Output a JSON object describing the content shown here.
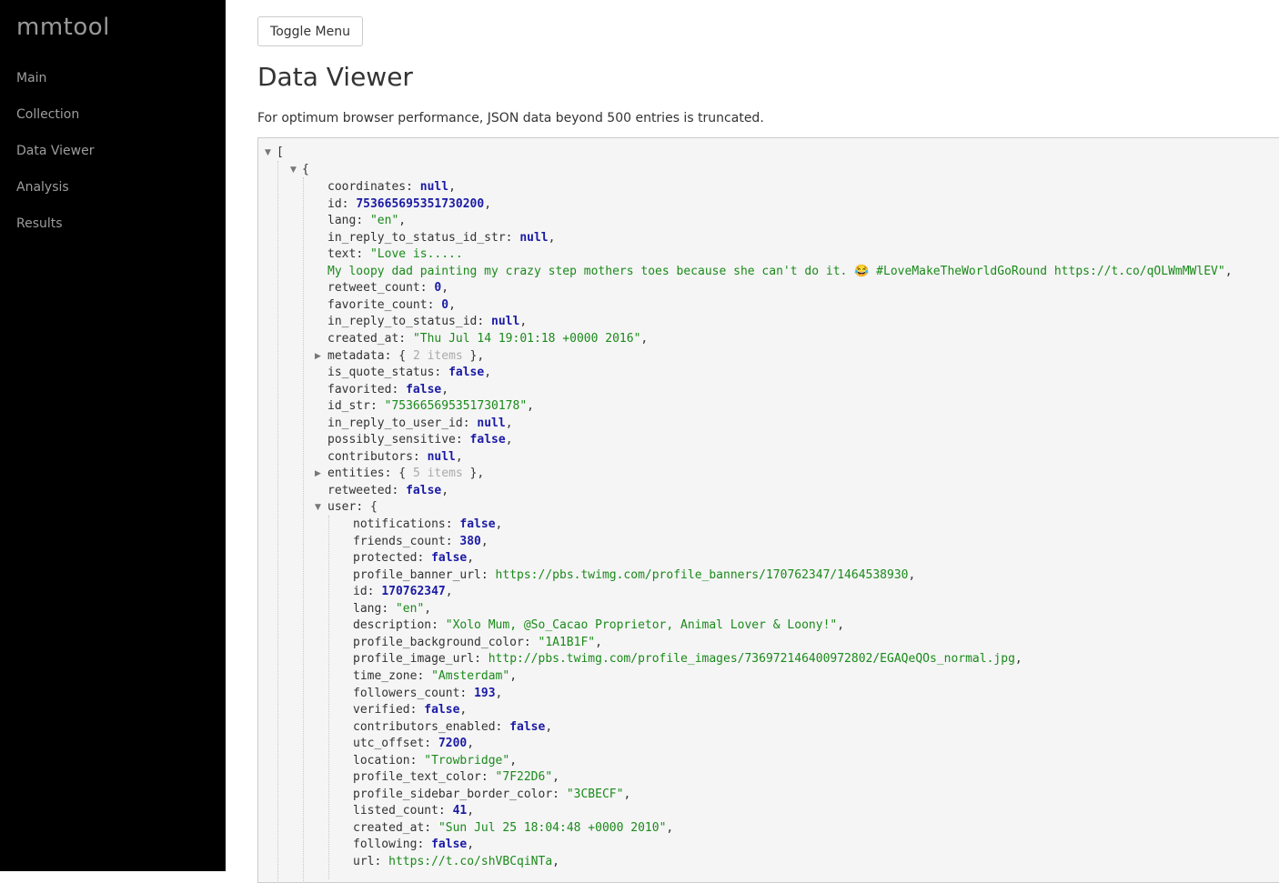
{
  "app": {
    "brand": "mmtool",
    "nav": [
      "Main",
      "Collection",
      "Data Viewer",
      "Analysis",
      "Results"
    ]
  },
  "toolbar": {
    "toggle_label": "Toggle Menu"
  },
  "page": {
    "title": "Data Viewer",
    "notice": "For optimum browser performance, JSON data beyond 500 entries is truncated."
  },
  "colors": {
    "sidebar_bg": "#000000",
    "viewer_bg": "#f5f5f5",
    "string": "#1a8a1a",
    "literal": "#1a1aa6",
    "collapsed_hint": "#aaaaaa"
  },
  "icons": {
    "expanded": "triangle-down-icon",
    "collapsed": "triangle-right-icon"
  },
  "json": {
    "root_open": "[",
    "item_open": "{",
    "fields": [
      {
        "key": "coordinates",
        "value": "null",
        "type": "literal"
      },
      {
        "key": "id",
        "value": "753665695351730200",
        "type": "literal"
      },
      {
        "key": "lang",
        "value": "\"en\"",
        "type": "string"
      },
      {
        "key": "in_reply_to_status_id_str",
        "value": "null",
        "type": "literal"
      },
      {
        "key": "text",
        "value": "\"Love is.....",
        "type": "string"
      },
      {
        "key": "retweet_count",
        "value": "0",
        "type": "literal"
      },
      {
        "key": "favorite_count",
        "value": "0",
        "type": "literal"
      },
      {
        "key": "in_reply_to_status_id",
        "value": "null",
        "type": "literal"
      },
      {
        "key": "created_at",
        "value": "\"Thu Jul 14 19:01:18 +0000 2016\"",
        "type": "string"
      },
      {
        "key": "metadata",
        "value": "2 items",
        "type": "collapsed"
      },
      {
        "key": "is_quote_status",
        "value": "false",
        "type": "literal"
      },
      {
        "key": "favorited",
        "value": "false",
        "type": "literal"
      },
      {
        "key": "id_str",
        "value": "\"753665695351730178\"",
        "type": "string"
      },
      {
        "key": "in_reply_to_user_id",
        "value": "null",
        "type": "literal"
      },
      {
        "key": "possibly_sensitive",
        "value": "false",
        "type": "literal"
      },
      {
        "key": "contributors",
        "value": "null",
        "type": "literal"
      },
      {
        "key": "entities",
        "value": "5 items",
        "type": "collapsed"
      },
      {
        "key": "retweeted",
        "value": "false",
        "type": "literal"
      },
      {
        "key": "user",
        "value": "{",
        "type": "open"
      }
    ],
    "text_continuation": "My loopy dad painting my crazy step mothers toes because she can't do it. 😂 #LoveMakeTheWorldGoRound https://t.co/qOLWmMWlEV\"",
    "user_fields": [
      {
        "key": "notifications",
        "value": "false",
        "type": "literal"
      },
      {
        "key": "friends_count",
        "value": "380",
        "type": "literal"
      },
      {
        "key": "protected",
        "value": "false",
        "type": "literal"
      },
      {
        "key": "profile_banner_url",
        "value": "https://pbs.twimg.com/profile_banners/170762347/1464538930",
        "type": "string"
      },
      {
        "key": "id",
        "value": "170762347",
        "type": "literal"
      },
      {
        "key": "lang",
        "value": "\"en\"",
        "type": "string"
      },
      {
        "key": "description",
        "value": "\"Xolo Mum, @So_Cacao Proprietor, Animal Lover & Loony!\"",
        "type": "string"
      },
      {
        "key": "profile_background_color",
        "value": "\"1A1B1F\"",
        "type": "string"
      },
      {
        "key": "profile_image_url",
        "value": "http://pbs.twimg.com/profile_images/736972146400972802/EGAQeQOs_normal.jpg",
        "type": "string"
      },
      {
        "key": "time_zone",
        "value": "\"Amsterdam\"",
        "type": "string"
      },
      {
        "key": "followers_count",
        "value": "193",
        "type": "literal"
      },
      {
        "key": "verified",
        "value": "false",
        "type": "literal"
      },
      {
        "key": "contributors_enabled",
        "value": "false",
        "type": "literal"
      },
      {
        "key": "utc_offset",
        "value": "7200",
        "type": "literal"
      },
      {
        "key": "location",
        "value": "\"Trowbridge\"",
        "type": "string"
      },
      {
        "key": "profile_text_color",
        "value": "\"7F22D6\"",
        "type": "string"
      },
      {
        "key": "profile_sidebar_border_color",
        "value": "\"3CBECF\"",
        "type": "string"
      },
      {
        "key": "listed_count",
        "value": "41",
        "type": "literal"
      },
      {
        "key": "created_at",
        "value": "\"Sun Jul 25 18:04:48 +0000 2010\"",
        "type": "string"
      },
      {
        "key": "following",
        "value": "false",
        "type": "literal"
      },
      {
        "key": "url",
        "value": "https://t.co/shVBCqiNTa",
        "type": "string"
      }
    ]
  }
}
